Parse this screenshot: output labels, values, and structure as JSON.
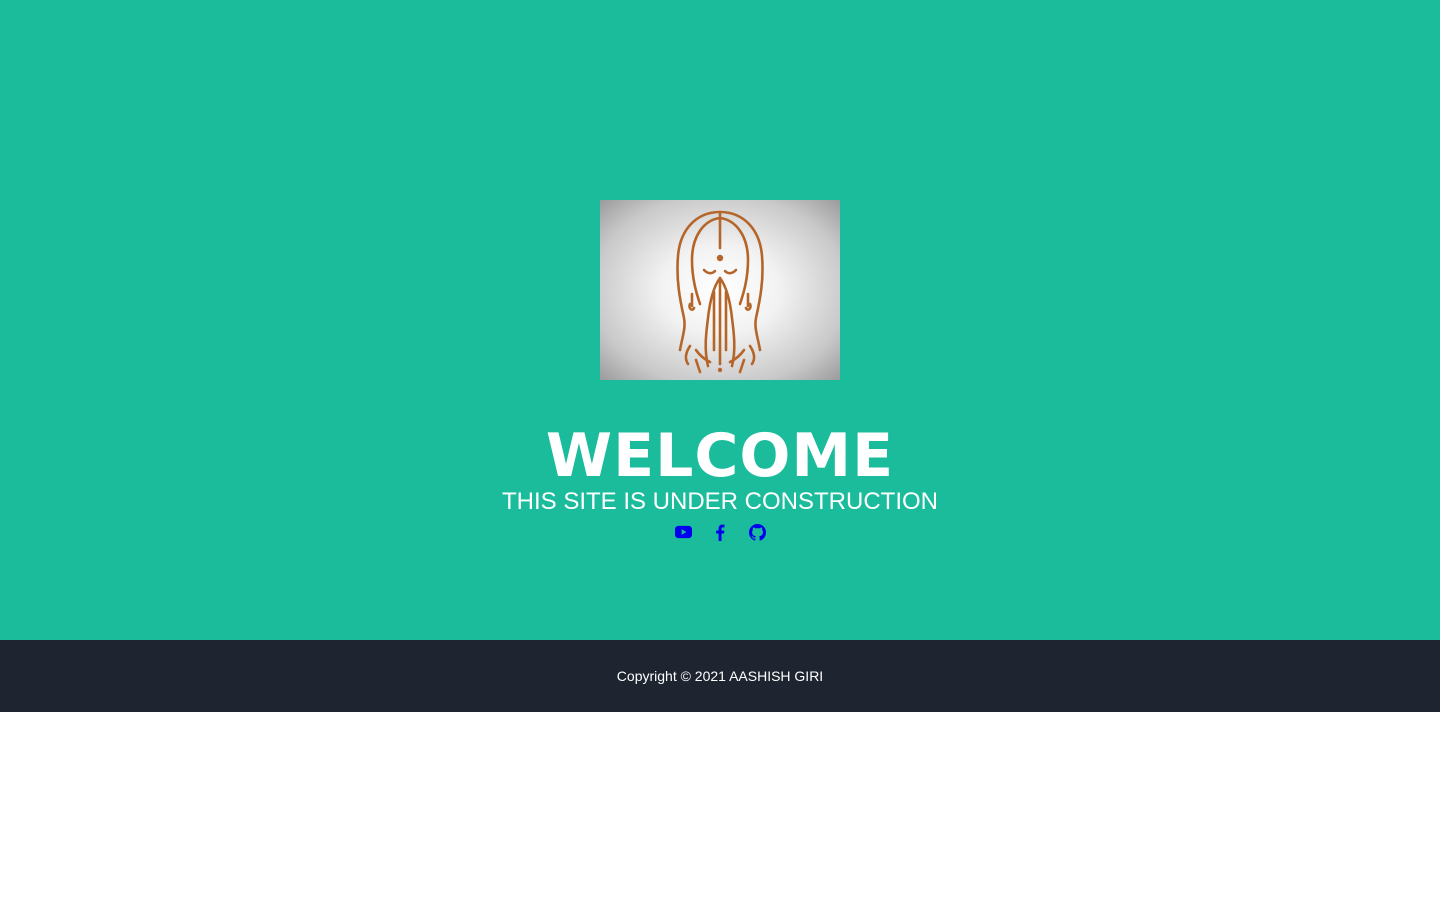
{
  "hero": {
    "background_color": "#1abc9c",
    "logo": {
      "icon": "namaste-woman-illustration",
      "line_color": "#b5652a"
    },
    "title": "WELCOME",
    "subtitle": "THIS SITE IS UNDER CONSTRUCTION"
  },
  "social": {
    "icon_color": "#0000ee",
    "links": [
      {
        "icon": "youtube-icon"
      },
      {
        "icon": "facebook-icon"
      },
      {
        "icon": "github-icon"
      }
    ]
  },
  "footer": {
    "background_color": "#1e2530",
    "copyright": "Copyright © 2021 AASHISH GIRI"
  }
}
